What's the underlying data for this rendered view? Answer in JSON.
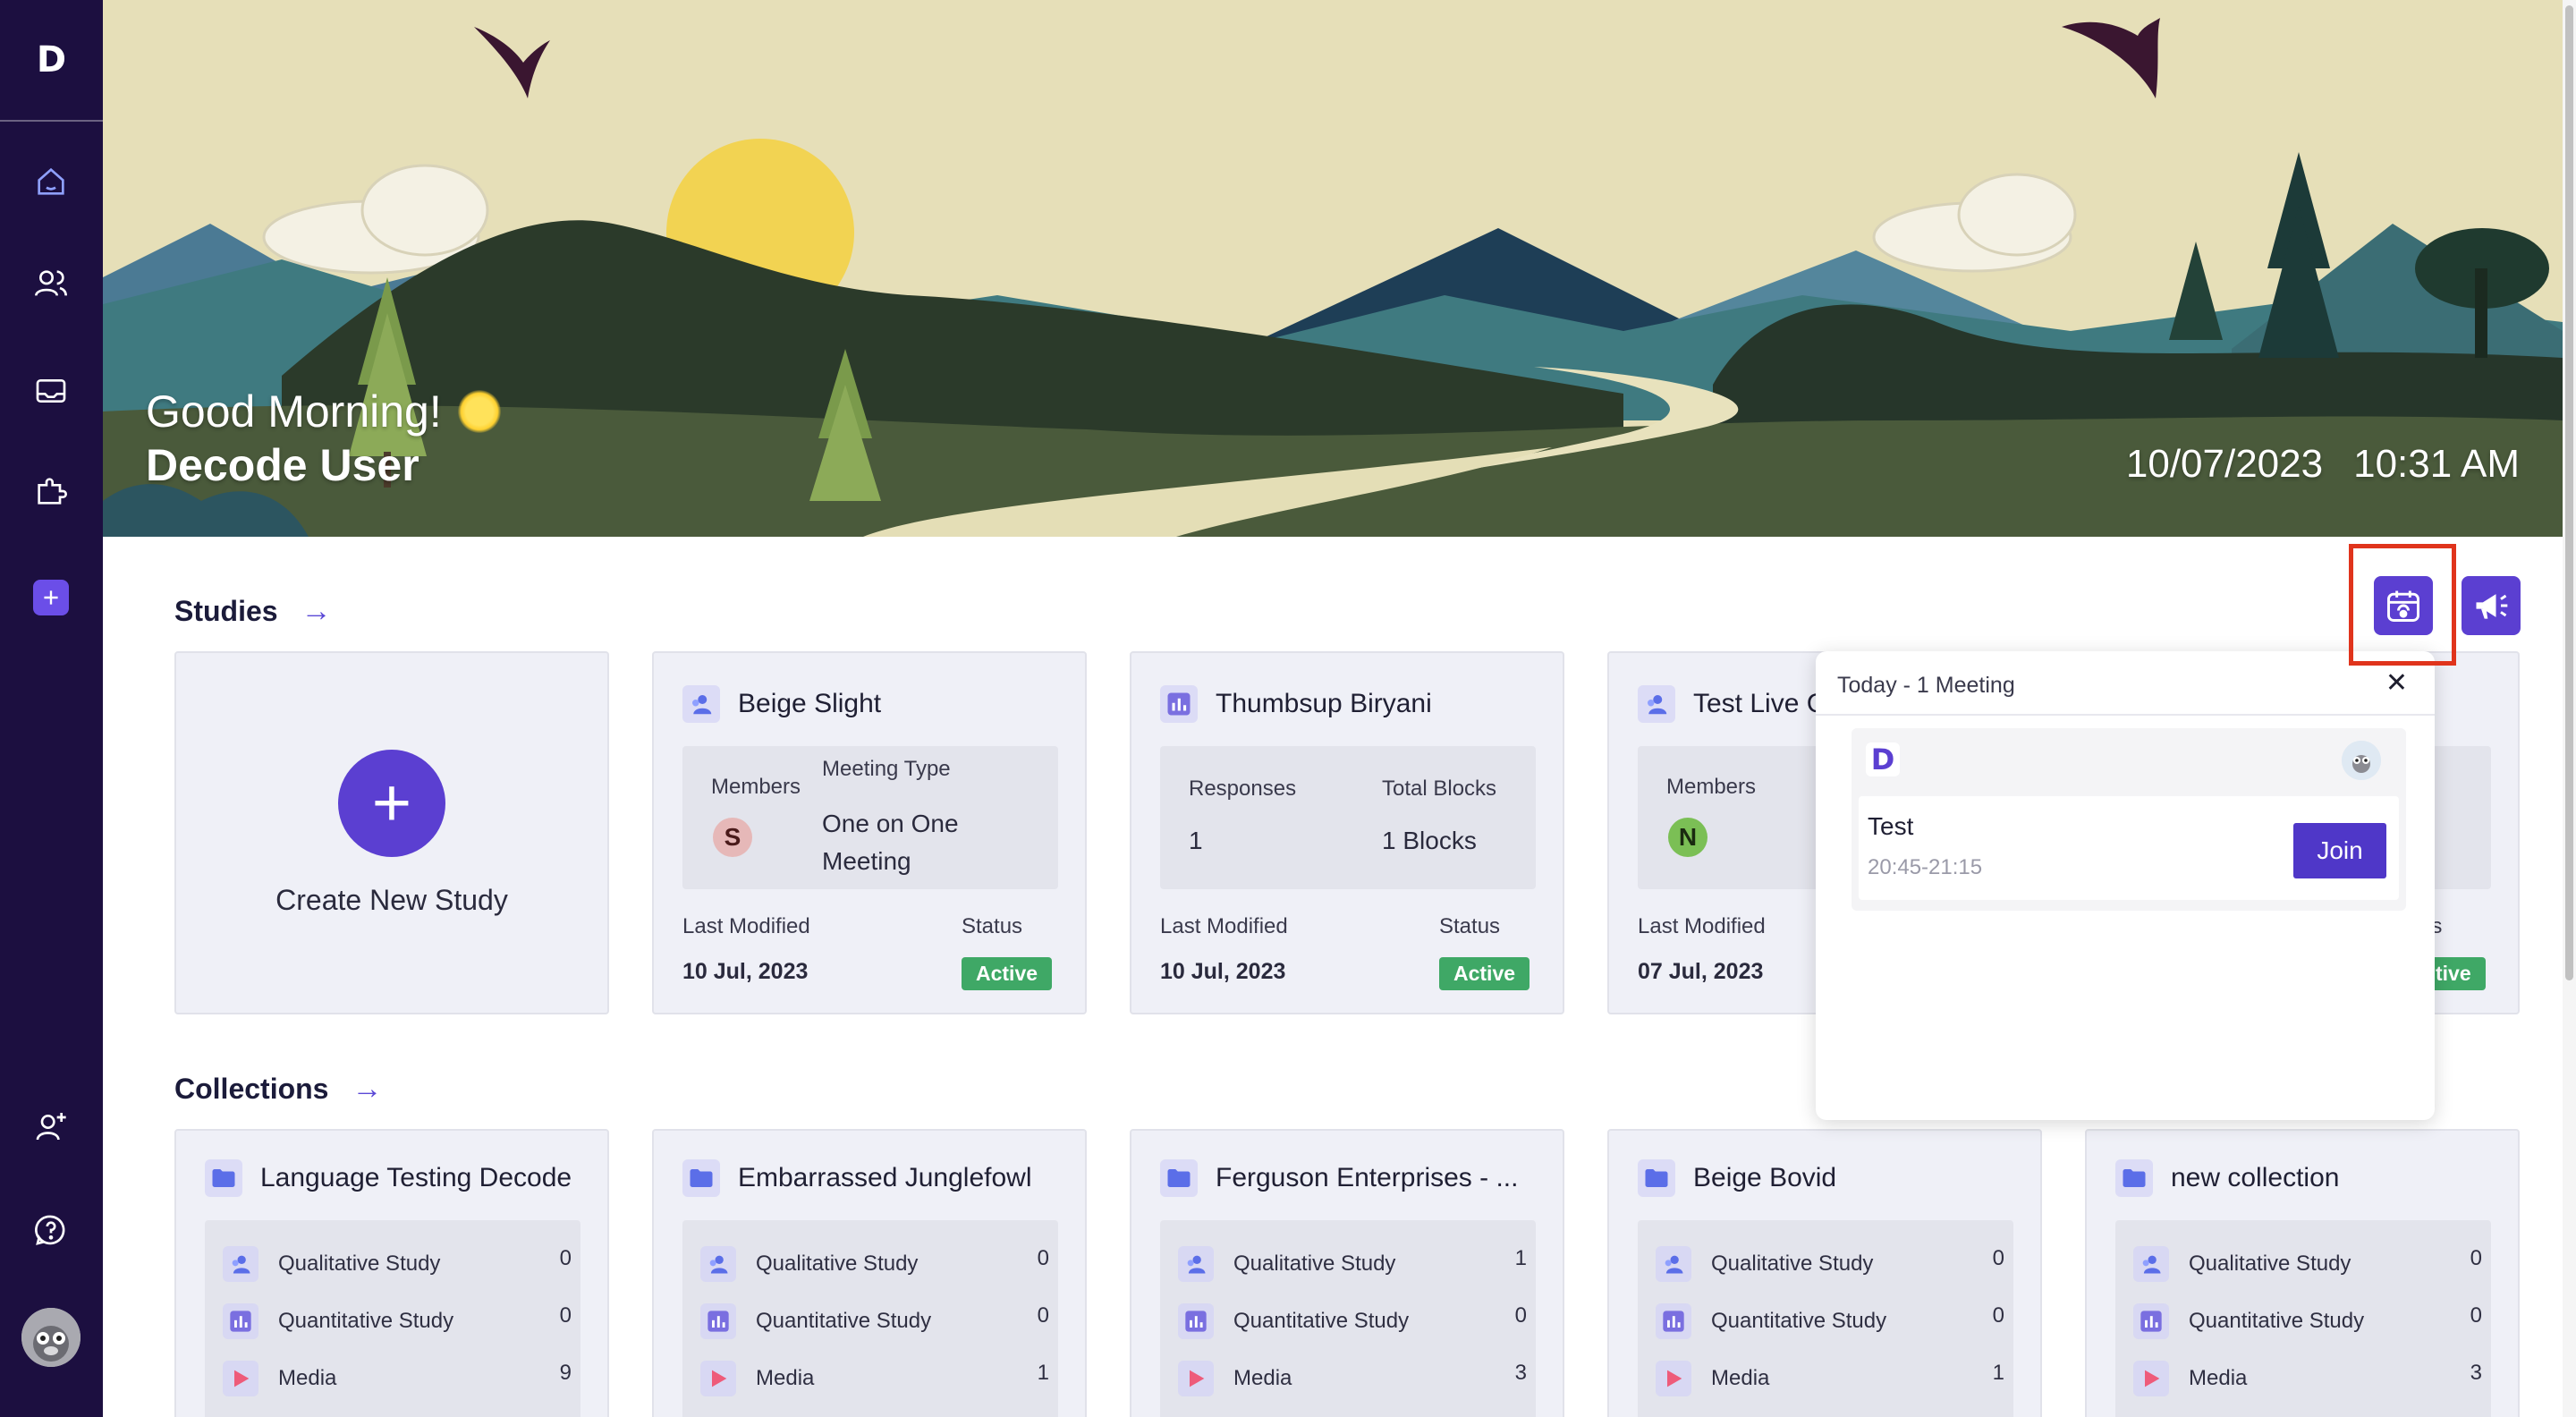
{
  "sidebar": {
    "logo": "D",
    "nav": [
      {
        "name": "home-icon"
      },
      {
        "name": "users-icon"
      },
      {
        "name": "inbox-icon"
      },
      {
        "name": "puzzle-icon"
      },
      {
        "name": "add-icon"
      }
    ],
    "bottom": [
      {
        "name": "add-user-icon"
      },
      {
        "name": "help-icon"
      },
      {
        "name": "avatar"
      }
    ]
  },
  "hero": {
    "greeting": "Good Morning!",
    "user_name": "Decode User",
    "date": "10/07/2023",
    "time": "10:31 AM"
  },
  "studies": {
    "title": "Studies",
    "create_label": "Create New Study",
    "cards": [
      {
        "title": "Beige Slight",
        "kind": "qualitative",
        "members_label": "Members",
        "member_initial": "S",
        "meeting_type_label": "Meeting Type",
        "meeting_type": "One on One Meeting",
        "last_modified_label": "Last Modified",
        "last_modified": "10 Jul, 2023",
        "status_label": "Status",
        "status": "Active"
      },
      {
        "title": "Thumbsup Biryani",
        "kind": "quantitative",
        "responses_label": "Responses",
        "responses": "1",
        "blocks_label": "Total Blocks",
        "blocks": "1 Blocks",
        "last_modified_label": "Last Modified",
        "last_modified": "10 Jul, 2023",
        "status_label": "Status",
        "status": "Active"
      },
      {
        "title": "Test Live C",
        "kind": "qualitative",
        "members_label": "Members",
        "member_initial": "N",
        "last_modified_label": "Last Modified",
        "last_modified": "07 Jul, 2023",
        "status_label_partial": "us",
        "status_partial": "tive"
      }
    ]
  },
  "collections": {
    "title": "Collections",
    "row_labels": [
      "Qualitative Study",
      "Quantitative Study",
      "Media"
    ],
    "cards": [
      {
        "title": "Language Testing Decode",
        "counts": [
          "0",
          "0",
          "9"
        ]
      },
      {
        "title": "Embarrassed Junglefowl",
        "counts": [
          "0",
          "0",
          "1"
        ]
      },
      {
        "title": "Ferguson Enterprises - ...",
        "counts": [
          "1",
          "0",
          "3"
        ]
      },
      {
        "title": "Beige Bovid",
        "counts": [
          "0",
          "0",
          "1"
        ]
      },
      {
        "title": "new collection",
        "counts": [
          "0",
          "0",
          "3"
        ]
      }
    ]
  },
  "popup": {
    "title": "Today - 1 Meeting",
    "close": "✕",
    "meeting": {
      "logo": "D",
      "name": "Test",
      "time": "20:45-21:15",
      "join_label": "Join"
    }
  },
  "colors": {
    "sidebar": "#1c0f40",
    "accent": "#5b3fd1",
    "active_badge": "#3fa866",
    "highlight": "#e0341c"
  }
}
